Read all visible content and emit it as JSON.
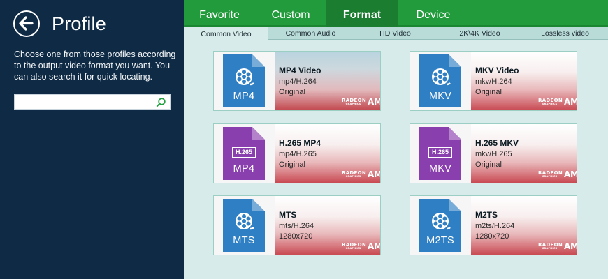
{
  "sidebar": {
    "title": "Profile",
    "description": "Choose one from those profiles according to the output video format you want. You can also search it for quick locating.",
    "search": {
      "value": "",
      "placeholder": ""
    }
  },
  "tabs": [
    {
      "label": "Favorite",
      "active": false
    },
    {
      "label": "Custom",
      "active": false
    },
    {
      "label": "Format",
      "active": true
    },
    {
      "label": "Device",
      "active": false
    }
  ],
  "subtabs": [
    {
      "label": "Common Video",
      "active": true
    },
    {
      "label": "Common Audio",
      "active": false
    },
    {
      "label": "HD Video",
      "active": false
    },
    {
      "label": "2K\\4K Video",
      "active": false
    },
    {
      "label": "Lossless video",
      "active": false
    }
  ],
  "profiles": [
    {
      "name": "MP4 Video",
      "codec": "mp4/H.264",
      "extra": "Original",
      "icon_label": "MP4",
      "icon_badge": "",
      "icon_color": "#2f7fc4",
      "selected": true
    },
    {
      "name": "MKV Video",
      "codec": "mkv/H.264",
      "extra": "Original",
      "icon_label": "MKV",
      "icon_badge": "",
      "icon_color": "#2f7fc4",
      "selected": false
    },
    {
      "name": "H.265 MP4",
      "codec": "mp4/H.265",
      "extra": "Original",
      "icon_label": "MP4",
      "icon_badge": "H.265",
      "icon_color": "#8a3fae",
      "selected": false
    },
    {
      "name": "H.265 MKV",
      "codec": "mkv/H.265",
      "extra": "Original",
      "icon_label": "MKV",
      "icon_badge": "H.265",
      "icon_color": "#8a3fae",
      "selected": false
    },
    {
      "name": "MTS",
      "codec": "mts/H.264",
      "extra": "1280x720",
      "icon_label": "MTS",
      "icon_badge": "",
      "icon_color": "#2f7fc4",
      "selected": false
    },
    {
      "name": "M2TS",
      "codec": "m2ts/H.264",
      "extra": "1280x720",
      "icon_label": "M2TS",
      "icon_badge": "",
      "icon_color": "#2f7fc4",
      "selected": false
    }
  ],
  "branding": {
    "radeon": "RADEON",
    "radeon_sub": "GRAPHICS",
    "amd": "AMD"
  },
  "colors": {
    "sidebar_bg": "#0f2a44",
    "tab_bar": "#229b3c",
    "content_bg": "#d7ecea",
    "video_icon": "#2f7fc4",
    "h265_icon": "#8a3fae",
    "amd_red": "#c94a53"
  }
}
